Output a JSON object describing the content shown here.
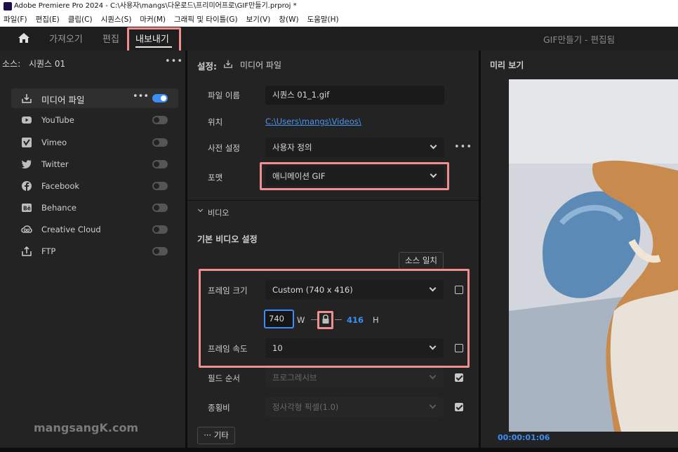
{
  "window": {
    "title": "Adobe Premiere Pro 2024 - C:\\사용자\\mangs\\다운로드\\프리미어프로\\GIF만들기.prproj *"
  },
  "menu": [
    "파일(F)",
    "편집(E)",
    "클립(C)",
    "시퀀스(S)",
    "마커(M)",
    "그래픽 및 타이틀(G)",
    "보기(V)",
    "창(W)",
    "도움말(H)"
  ],
  "workspace": {
    "tabs": [
      "가져오기",
      "편집",
      "내보내기"
    ],
    "active_tab": "내보내기",
    "project_label": "GIF만들기 - 편집됨"
  },
  "source": {
    "label": "소스:",
    "name": "시퀀스 01"
  },
  "destinations": [
    {
      "label": "미디어 파일",
      "icon": "download-icon",
      "on": true
    },
    {
      "label": "YouTube",
      "icon": "youtube-icon",
      "on": false
    },
    {
      "label": "Vimeo",
      "icon": "vimeo-icon",
      "on": false
    },
    {
      "label": "Twitter",
      "icon": "twitter-icon",
      "on": false
    },
    {
      "label": "Facebook",
      "icon": "facebook-icon",
      "on": false
    },
    {
      "label": "Behance",
      "icon": "behance-icon",
      "on": false
    },
    {
      "label": "Creative Cloud",
      "icon": "creative-cloud-icon",
      "on": false
    },
    {
      "label": "FTP",
      "icon": "upload-icon",
      "on": false
    }
  ],
  "settings": {
    "header": "설정:",
    "header_target": "미디어 파일",
    "file_name_label": "파일 이름",
    "file_name": "시퀀스 01_1.gif",
    "location_label": "위치",
    "location": "C:\\Users\\mangs\\Videos\\",
    "preset_label": "사전 설정",
    "preset": "사용자 정의",
    "format_label": "포맷",
    "format": "애니메이션 GIF",
    "video_section": "비디오",
    "basic_video_settings": "기본 비디오 설정",
    "match_source_button": "소스 일치",
    "frame_size_label": "프레임 크기",
    "frame_size": "Custom (740 x 416)",
    "width": "740",
    "width_unit": "W",
    "height": "416",
    "height_unit": "H",
    "frame_rate_label": "프레임 속도",
    "frame_rate": "10",
    "field_order_label": "필드 순서",
    "field_order": "프로그레시브",
    "aspect_label": "종횡비",
    "aspect": "정사각형 픽셀(1.0)",
    "more_button": "기타"
  },
  "preview": {
    "title": "미리 보기",
    "timecode": "00:00:01:06"
  },
  "watermark": "mangsangK.com",
  "colors": {
    "accent": "#3b8ef5",
    "highlight": "#f08e92",
    "panel": "#232323"
  }
}
